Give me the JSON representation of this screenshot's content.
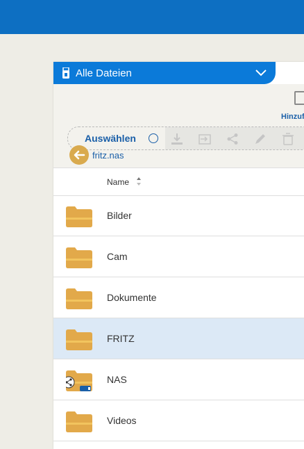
{
  "header": {
    "dropdown_label": "Alle Dateien"
  },
  "toolbar": {
    "add_label": "Hinzuf",
    "select_label": "Auswählen"
  },
  "breadcrumb": {
    "current": "fritz.nas"
  },
  "table": {
    "column_name": "Name"
  },
  "folders": [
    {
      "label": "Bilder",
      "selected": false,
      "shared": false
    },
    {
      "label": "Cam",
      "selected": false,
      "shared": false
    },
    {
      "label": "Dokumente",
      "selected": false,
      "shared": false
    },
    {
      "label": "FRITZ",
      "selected": true,
      "shared": false
    },
    {
      "label": "NAS",
      "selected": false,
      "shared": true
    },
    {
      "label": "Videos",
      "selected": false,
      "shared": false
    }
  ],
  "colors": {
    "accent": "#0b7ad9",
    "folder": "#e2a94a",
    "selected_row": "#dce9f6"
  }
}
